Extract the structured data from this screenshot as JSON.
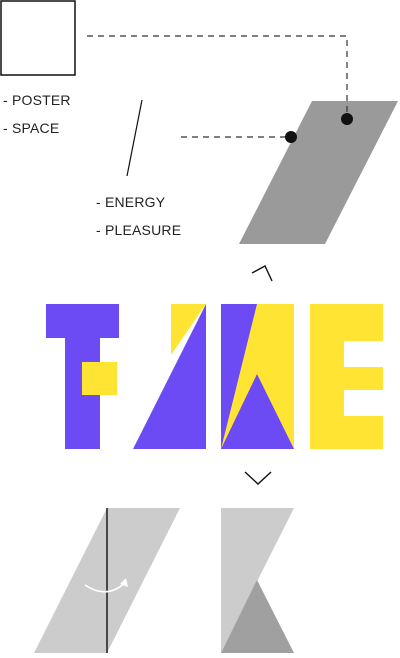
{
  "labels": {
    "group_one": [
      "- POSTER",
      "- SPACE"
    ],
    "group_two": [
      "- ENERGY",
      "- PLEASURE"
    ]
  },
  "colors": {
    "purple": "#6c4bf5",
    "yellow": "#ffe433",
    "dark_gray": "#9a9a9a",
    "light_gray": "#cccccc",
    "mid_gray": "#a0a0a0",
    "line": "#111111",
    "dash": "#333333"
  },
  "icons": [
    "chevron-up-icon",
    "chevron-down-icon",
    "curved-arrow-icon"
  ]
}
